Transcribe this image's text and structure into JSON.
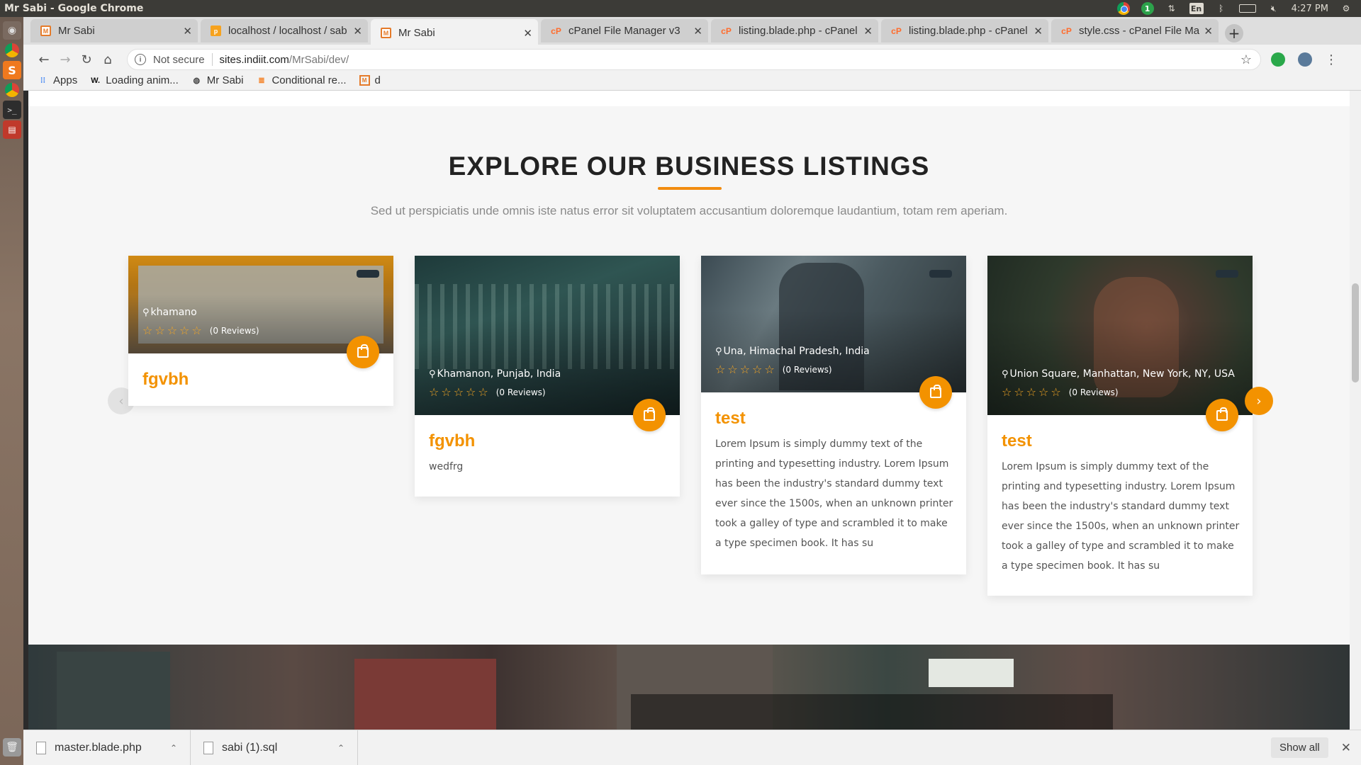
{
  "os": {
    "window_title": "Mr Sabi - Google Chrome",
    "lang": "En",
    "clock": "4:27 PM",
    "notification_count": "1"
  },
  "tabs": [
    {
      "label": "Mr Sabi",
      "favicon": "mrsabi-icon",
      "active": false
    },
    {
      "label": "localhost / localhost / sab",
      "favicon": "phpmyadmin-icon",
      "active": false
    },
    {
      "label": "Mr Sabi",
      "favicon": "mrsabi-icon",
      "active": true
    },
    {
      "label": "cPanel File Manager v3",
      "favicon": "cpanel-icon",
      "active": false
    },
    {
      "label": "listing.blade.php - cPanel",
      "favicon": "cpanel-icon",
      "active": false
    },
    {
      "label": "listing.blade.php - cPanel",
      "favicon": "cpanel-icon",
      "active": false
    },
    {
      "label": "style.css - cPanel File Man",
      "favicon": "cpanel-icon",
      "active": false
    }
  ],
  "toolbar": {
    "not_secure": "Not secure",
    "url_host": "sites.indiit.com",
    "url_path": "/MrSabi/dev/"
  },
  "bookmarks": [
    {
      "label": "Apps",
      "icon": "apps-grid-icon"
    },
    {
      "label": "Loading anim...",
      "icon": "w-logo-icon"
    },
    {
      "label": "Mr Sabi",
      "icon": "globe-icon"
    },
    {
      "label": "Conditional re...",
      "icon": "stack-icon"
    },
    {
      "label": "d",
      "icon": "mrsabi-icon"
    }
  ],
  "section": {
    "title": "EXPLORE OUR BUSINESS LISTINGS",
    "subtitle": "Sed ut perspiciatis unde omnis iste natus error sit voluptatem accusantium doloremque laudantium, totam rem aperiam."
  },
  "listings": [
    {
      "location": "khamano",
      "reviews": "(0 Reviews)",
      "title": "fgvbh",
      "description": ""
    },
    {
      "location": "Khamanon, Punjab, India",
      "reviews": "(0 Reviews)",
      "title": "fgvbh",
      "description": "wedfrg"
    },
    {
      "location": "Una, Himachal Pradesh, India",
      "reviews": "(0 Reviews)",
      "title": "test",
      "description": "Lorem Ipsum is simply dummy text of the printing and typesetting industry. Lorem Ipsum has been the industry's standard dummy text ever since the 1500s, when an unknown printer took a galley of type and scrambled it to make a type specimen book. It has su"
    },
    {
      "location": "Union Square, Manhattan, New York, NY, USA",
      "reviews": "(0 Reviews)",
      "title": "test",
      "description": "Lorem Ipsum is simply dummy text of the printing and typesetting industry. Lorem Ipsum has been the industry's standard dummy text ever since the 1500s, when an unknown printer took a galley of type and scrambled it to make a type specimen book. It has su"
    }
  ],
  "ratings": {
    "filled": 0,
    "max": 5
  },
  "downloads": [
    {
      "name": "master.blade.php"
    },
    {
      "name": "sabi (1).sql"
    }
  ],
  "download_bar": {
    "show_all": "Show all"
  },
  "colors": {
    "accent": "#f39200",
    "title": "#222222"
  }
}
